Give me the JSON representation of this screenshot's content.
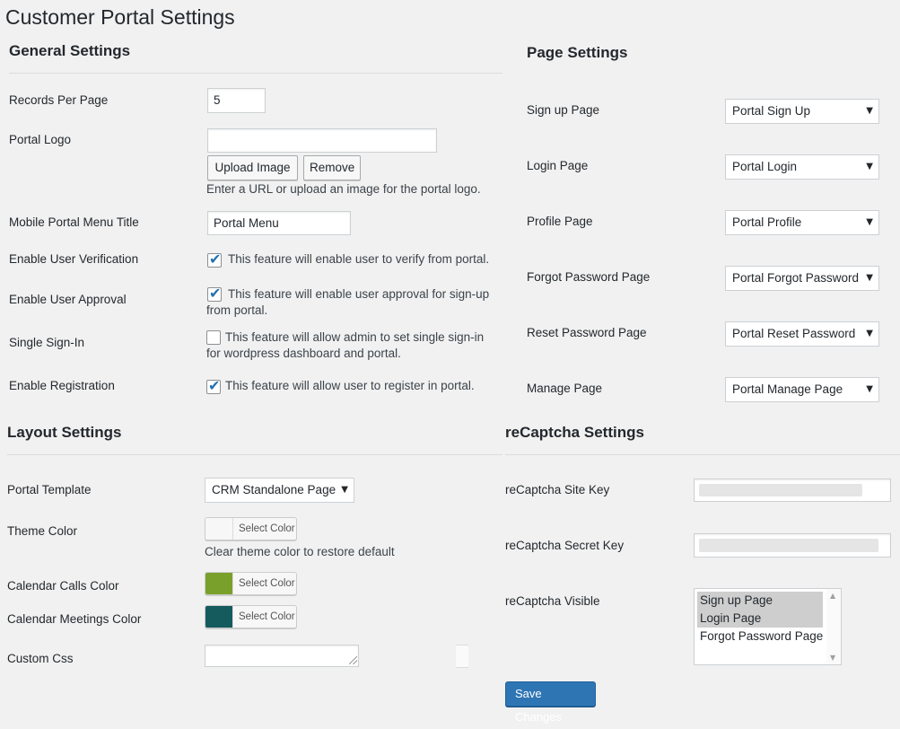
{
  "page": {
    "title": "Customer Portal Settings"
  },
  "general": {
    "heading": "General Settings",
    "records_per_page": {
      "label": "Records Per Page",
      "value": "5"
    },
    "portal_logo": {
      "label": "Portal Logo",
      "value": "",
      "upload_label": "Upload Image",
      "remove_label": "Remove",
      "help": "Enter a URL or upload an image for the portal logo."
    },
    "mobile_menu_title": {
      "label": "Mobile Portal Menu Title",
      "value": "Portal Menu"
    },
    "user_verification": {
      "label": "Enable User Verification",
      "checked": true,
      "text": "This feature will enable user to verify from portal."
    },
    "user_approval": {
      "label": "Enable User Approval",
      "checked": true,
      "text_line1": "This feature will enable user approval for sign-up",
      "text_line2": "from portal."
    },
    "single_sign_in": {
      "label": "Single Sign-In",
      "checked": false,
      "text_line1": "This feature will allow admin to set single sign-in",
      "text_line2": "for wordpress dashboard and portal."
    },
    "registration": {
      "label": "Enable Registration",
      "checked": true,
      "text": "This feature will allow user to register in portal."
    }
  },
  "page_settings": {
    "heading": "Page Settings",
    "rows": [
      {
        "label": "Sign up Page",
        "value": "Portal Sign Up"
      },
      {
        "label": "Login Page",
        "value": "Portal Login"
      },
      {
        "label": "Profile Page",
        "value": "Portal Profile"
      },
      {
        "label": "Forgot Password Page",
        "value": "Portal Forgot Password"
      },
      {
        "label": "Reset Password Page",
        "value": "Portal Reset Password"
      },
      {
        "label": "Manage Page",
        "value": "Portal Manage Page"
      }
    ]
  },
  "layout": {
    "heading": "Layout Settings",
    "portal_template": {
      "label": "Portal Template",
      "value": "CRM Standalone Page"
    },
    "theme_color": {
      "label": "Theme Color",
      "button": "Select Color",
      "color": "#f7f7f7",
      "help": "Clear theme color to restore default"
    },
    "calls_color": {
      "label": "Calendar Calls Color",
      "button": "Select Color",
      "color": "#7aa02c"
    },
    "meetings_color": {
      "label": "Calendar Meetings Color",
      "button": "Select Color",
      "color": "#155a5d"
    },
    "custom_css": {
      "label": "Custom Css",
      "value": ""
    }
  },
  "recaptcha": {
    "heading": "reCaptcha Settings",
    "site_key": {
      "label": "reCaptcha Site Key"
    },
    "secret_key": {
      "label": "reCaptcha Secret Key"
    },
    "visible": {
      "label": "reCaptcha Visible",
      "options": [
        {
          "label": "Sign up Page",
          "selected": true
        },
        {
          "label": "Login Page",
          "selected": true
        },
        {
          "label": "Forgot Password Page",
          "selected": false
        }
      ]
    }
  },
  "save_label": "Save Changes",
  "colors": {
    "primary": "#2e75b3",
    "checkmark": "#2271b1"
  }
}
